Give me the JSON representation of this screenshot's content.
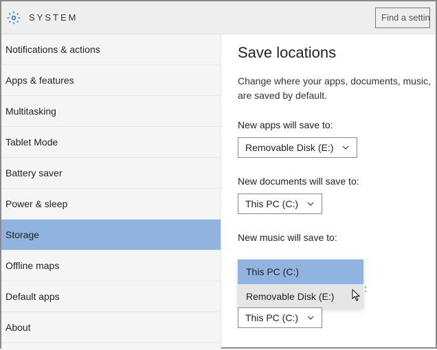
{
  "header": {
    "title": "SYSTEM",
    "search_placeholder": "Find a settin"
  },
  "sidebar": {
    "items": [
      {
        "label": "Notifications & actions"
      },
      {
        "label": "Apps & features"
      },
      {
        "label": "Multitasking"
      },
      {
        "label": "Tablet Mode"
      },
      {
        "label": "Battery saver"
      },
      {
        "label": "Power & sleep"
      },
      {
        "label": "Storage"
      },
      {
        "label": "Offline maps"
      },
      {
        "label": "Default apps"
      },
      {
        "label": "About"
      }
    ],
    "selected_index": 6
  },
  "main": {
    "title": "Save locations",
    "description": "Change where your apps, documents, music, are saved by default.",
    "settings": [
      {
        "label": "New apps will save to:",
        "value": "Removable Disk (E:)"
      },
      {
        "label": "New documents will save to:",
        "value": "This PC (C:)"
      },
      {
        "label": "New music will save to:",
        "value": "This PC (C:)"
      }
    ],
    "open_dropdown": {
      "options": [
        "This PC (C:)",
        "Removable Disk (E:)"
      ],
      "selected_index": 0
    },
    "dropdown_below_value": "This PC (C:)",
    "colon_extra": ":"
  }
}
